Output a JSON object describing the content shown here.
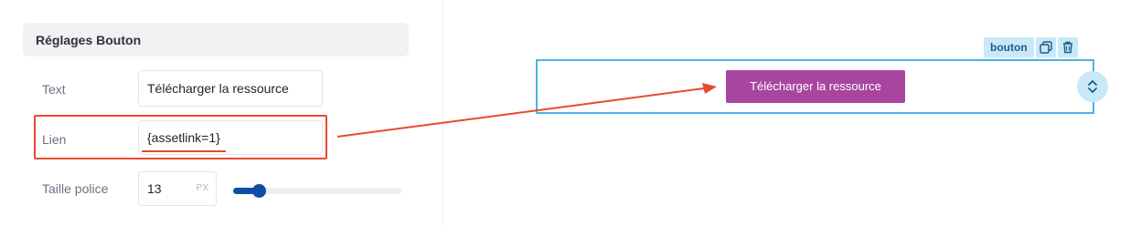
{
  "panel": {
    "title": "Réglages Bouton",
    "text_label": "Text",
    "text_value": "Télécharger la ressource",
    "link_label": "Lien",
    "link_value": "{assetlink=1}",
    "font_label": "Taille police",
    "font_value": "13",
    "font_unit": "PX",
    "font_slider_fraction": 0.13
  },
  "canvas": {
    "block_label": "bouton",
    "button_text": "Télécharger la ressource",
    "copy_icon": "copy-icon",
    "delete_icon": "trash-icon",
    "move_icon": "chevron-up-down-icon"
  },
  "colors": {
    "highlight": "#e84a2e",
    "selection": "#4ab3e6",
    "button": "#a8469f",
    "slider": "#0f4da8"
  }
}
